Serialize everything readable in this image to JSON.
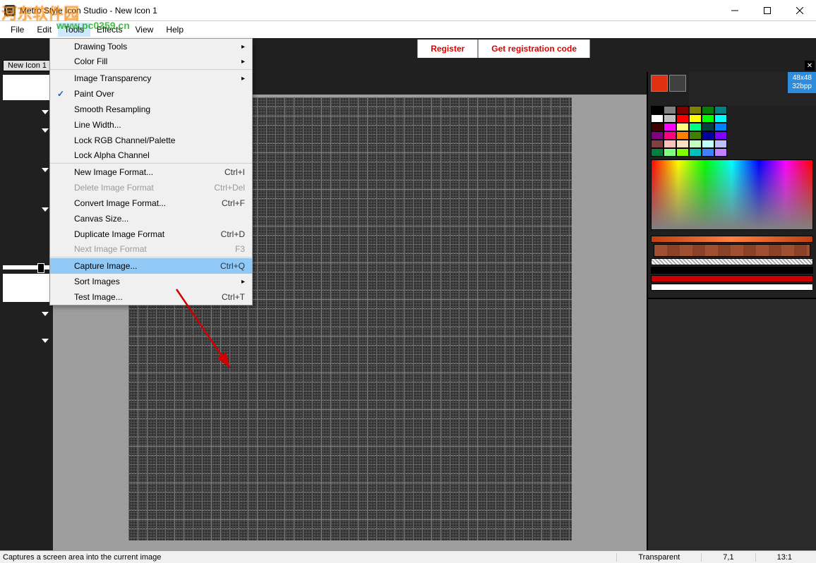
{
  "window": {
    "title": "Metro Style Icon Studio - New Icon 1"
  },
  "watermark": {
    "line1": "河东软件园",
    "line2": "www.pc0359.cn"
  },
  "menubar": {
    "file": "File",
    "edit": "Edit",
    "tools": "Tools",
    "effects": "Effects",
    "view": "View",
    "help": "Help"
  },
  "toolbar": {
    "register": "Register",
    "get_code": "Get registration code"
  },
  "tabs": {
    "tab1": "New Icon 1",
    "close": "✕"
  },
  "tools_menu": {
    "drawing_tools": "Drawing Tools",
    "color_fill": "Color Fill",
    "image_transparency": "Image Transparency",
    "paint_over": "Paint Over",
    "smooth_resampling": "Smooth Resampling",
    "line_width": "Line Width...",
    "lock_rgb": "Lock RGB Channel/Palette",
    "lock_alpha": "Lock Alpha Channel",
    "new_image_format": "New Image Format...",
    "new_image_format_sc": "Ctrl+I",
    "delete_image_format": "Delete Image Format",
    "delete_image_format_sc": "Ctrl+Del",
    "convert_image_format": "Convert Image Format...",
    "convert_image_format_sc": "Ctrl+F",
    "canvas_size": "Canvas Size...",
    "duplicate_image_format": "Duplicate Image Format",
    "duplicate_image_format_sc": "Ctrl+D",
    "next_image_format": "Next Image Format",
    "next_image_format_sc": "F3",
    "capture_image": "Capture Image...",
    "capture_image_sc": "Ctrl+Q",
    "sort_images": "Sort Images",
    "test_image": "Test Image...",
    "test_image_sc": "Ctrl+T"
  },
  "preview": {
    "size": "48x48",
    "depth": "32bpp"
  },
  "current_colors": {
    "fg": "#e03010",
    "bg": "#404040"
  },
  "palette_rows": [
    [
      "#000000",
      "#808080",
      "#800000",
      "#808000",
      "#008000",
      "#008080"
    ],
    [
      "#ffffff",
      "#c0c0c0",
      "#ff0000",
      "#ffff00",
      "#00ff00",
      "#00ffff"
    ],
    [
      "#400000",
      "#ff00ff",
      "#ffff80",
      "#00ff80",
      "#004040",
      "#0080ff"
    ],
    [
      "#800080",
      "#ff0080",
      "#ff8000",
      "#408000",
      "#0000a0",
      "#8000ff"
    ],
    [
      "#804040",
      "#ffc0c0",
      "#ffe0c0",
      "#c0ffc0",
      "#c0ffff",
      "#c0c0ff"
    ],
    [
      "#008040",
      "#80ff80",
      "#80ff00",
      "#00c0c0",
      "#4080ff",
      "#c080ff"
    ]
  ],
  "statusbar": {
    "hint": "Captures a screen area into the current image",
    "mode": "Transparent",
    "coords": "7,1",
    "zoom": "13:1"
  }
}
